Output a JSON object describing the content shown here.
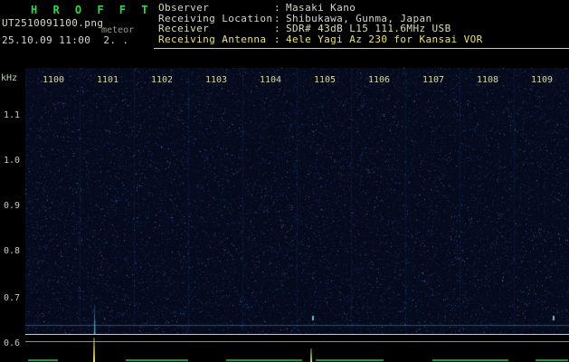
{
  "app": {
    "title": "H R O F F T",
    "filename": "UT2510091100.png",
    "observation": "meteor",
    "datetime": "25.10.09 11:00  2. ."
  },
  "header": {
    "colon": ":",
    "rows": [
      {
        "label": "Observer",
        "value": "Masaki Kano"
      },
      {
        "label": "Receiving Location",
        "value": "Shibukawa, Gunma, Japan"
      },
      {
        "label": "Receiver",
        "value": "SDR# 43dB L15 111.6MHz USB"
      },
      {
        "label": "Receiving Antenna",
        "value": "4ele Yagi Az 230 for Kansai VOR"
      }
    ]
  },
  "axes": {
    "y_unit": "kHz",
    "y_ticks": [
      "1.1",
      "1.0",
      "0.9",
      "0.8",
      "0.7",
      "0.6"
    ],
    "x_ticks": [
      "1100",
      "1101",
      "1102",
      "1103",
      "1104",
      "1105",
      "1106",
      "1107",
      "1108",
      "1109"
    ]
  },
  "colors": {
    "title_green": "#2fd54a",
    "header_text": "#d6d6ce",
    "antenna_yellow": "#e9e272",
    "axis_text": "#bcd0ba",
    "minute_text": "#d6d6a2",
    "divider_white": "#c9c9c1",
    "spike_yellow": "#f2de3e",
    "spike_green": "#a8e050",
    "baseline_green": "#1f8a3a",
    "echo_cyan": "#78c8eb"
  },
  "spectrogram": {
    "minutes": 10,
    "freq_top_khz": 1.2,
    "freq_bottom_khz": 0.6,
    "noise_seed": 20251009,
    "noise_dots": 16000,
    "base_color": "#050a1c",
    "noise_palette": [
      "rgba(22,46,96,0.45)",
      "rgba(36,70,140,0.5)",
      "rgba(58,104,180,0.55)",
      "rgba(110,160,220,0.6)"
    ],
    "grid_color": "rgba(50,90,170,0.15)",
    "carrier_khz": 0.62,
    "carrier_color": "rgba(70,145,185,0.5)",
    "echoes": [
      {
        "minute": 1.27,
        "khz_from": 0.665,
        "khz_to": 0.6,
        "type": "streak"
      },
      {
        "minute": 5.28,
        "khz_from": 0.64,
        "khz_to": 0.63,
        "type": "dot"
      },
      {
        "minute": 9.72,
        "khz_from": 0.64,
        "khz_to": 0.63,
        "type": "dot"
      }
    ]
  },
  "meter": {
    "spikes": [
      {
        "minute": 1.27,
        "height": 27,
        "color": "#f2de3e"
      },
      {
        "minute": 5.27,
        "height": 15,
        "color": "#a8e050"
      }
    ],
    "baseline_color": "#1f8a3a",
    "baseline_segments": [
      {
        "from": 0.05,
        "to": 0.6
      },
      {
        "from": 1.85,
        "to": 3.0
      },
      {
        "from": 3.7,
        "to": 5.1
      },
      {
        "from": 5.35,
        "to": 6.6
      },
      {
        "from": 7.5,
        "to": 8.9
      },
      {
        "from": 9.4,
        "to": 10.0
      }
    ]
  }
}
